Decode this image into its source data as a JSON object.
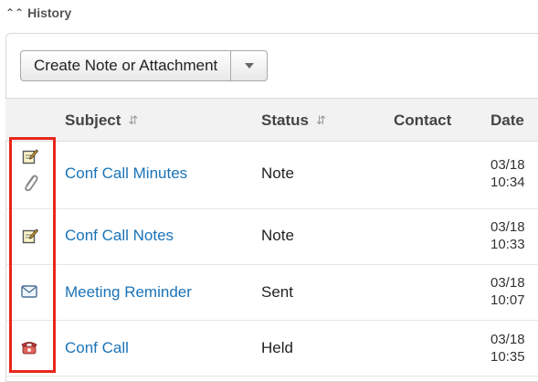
{
  "section": {
    "title": "History"
  },
  "toolbar": {
    "create_label": "Create Note or Attachment"
  },
  "columns": {
    "subject": "Subject",
    "status": "Status",
    "contact": "Contact",
    "date": "Date"
  },
  "rows": [
    {
      "icons": [
        "note-icon",
        "paperclip-icon"
      ],
      "subject": "Conf Call Minutes",
      "status": "Note",
      "date_line1": "03/18",
      "date_line2": "10:34"
    },
    {
      "icons": [
        "note-icon"
      ],
      "subject": "Conf Call Notes",
      "status": "Note",
      "date_line1": "03/18",
      "date_line2": "10:33"
    },
    {
      "icons": [
        "email-icon"
      ],
      "subject": "Meeting Reminder",
      "status": "Sent",
      "date_line1": "03/18",
      "date_line2": "10:07"
    },
    {
      "icons": [
        "phone-icon"
      ],
      "subject": "Conf Call",
      "status": "Held",
      "date_line1": "03/18",
      "date_line2": "10:35"
    }
  ],
  "colors": {
    "link": "#1a73b8",
    "highlight": "#e8261c",
    "header_bg": "#f2f2f2"
  }
}
